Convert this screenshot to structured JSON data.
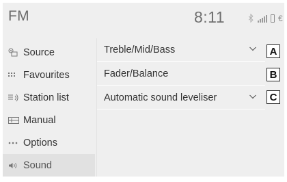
{
  "header": {
    "title": "FM",
    "clock": "8:11"
  },
  "sidebar": {
    "items": [
      {
        "label": "Source",
        "icon": "source-icon",
        "active": false
      },
      {
        "label": "Favourites",
        "icon": "favourites-icon",
        "active": false
      },
      {
        "label": "Station list",
        "icon": "station-list-icon",
        "active": false
      },
      {
        "label": "Manual",
        "icon": "manual-icon",
        "active": false
      },
      {
        "label": "Options",
        "icon": "options-icon",
        "active": false
      },
      {
        "label": "Sound",
        "icon": "sound-icon",
        "active": true
      }
    ]
  },
  "main": {
    "rows": [
      {
        "label": "Treble/Mid/Bass",
        "has_chevron": true,
        "callout": "A"
      },
      {
        "label": "Fader/Balance",
        "has_chevron": false,
        "callout": "B"
      },
      {
        "label": "Automatic sound leveliser",
        "has_chevron": true,
        "callout": "C"
      }
    ]
  },
  "colors": {
    "background": "#efefef",
    "active_item": "#e1e1e1",
    "text": "#333333"
  }
}
